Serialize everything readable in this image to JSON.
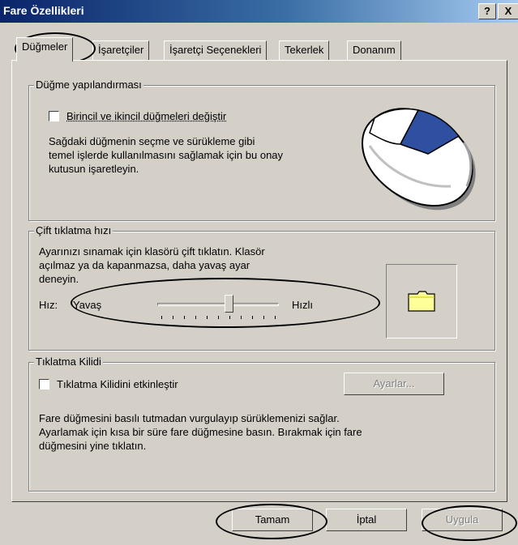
{
  "window": {
    "title": "Fare Özellikleri",
    "help_button": "?",
    "close_button": "X"
  },
  "tabs": [
    {
      "label": "Düğmeler",
      "active": true
    },
    {
      "label": "İşaretçiler",
      "active": false
    },
    {
      "label": "İşaretçi Seçenekleri",
      "active": false
    },
    {
      "label": "Tekerlek",
      "active": false
    },
    {
      "label": "Donanım",
      "active": false
    }
  ],
  "button_config": {
    "group_label": "Düğme yapılandırması",
    "checkbox_label": "Birincil ve ikincil düğmeleri değiştir",
    "checked": false,
    "desc_lines": [
      "Sağdaki düğmenin seçme ve sürükleme gibi",
      "temel işlerde kullanılmasını sağlamak için bu onay",
      "kutusun işaretleyin."
    ]
  },
  "double_click": {
    "group_label": "Çift tıklatma hızı",
    "desc_lines": [
      "Ayarınızı sınamak için klasörü çift tıklatın. Klasör",
      "açılmaz ya da kapanmazsa, daha yavaş ayar",
      "deneyin."
    ],
    "speed_label": "Hız:",
    "slow_label": "Yavaş",
    "fast_label": "Hızlı",
    "slider_level": 0.6
  },
  "click_lock": {
    "group_label": "Tıklatma Kilidi",
    "checkbox_label": "Tıklatma Kilidini etkinleştir",
    "checked": false,
    "settings_button": "Ayarlar...",
    "desc_lines": [
      "Fare düğmesini basılı tutmadan vurgulayıp sürüklemenizi sağlar.",
      "Ayarlamak için kısa bir süre fare düğmesine basın.  Bırakmak için fare",
      "düğmesini yine tıklatın."
    ]
  },
  "footer": {
    "ok": "Tamam",
    "cancel": "İptal",
    "apply": "Uygula"
  },
  "colors": {
    "title_gradient_start": "#0a246a",
    "dialog_bg": "#d4d0c8",
    "folder_yellow": "#ffff99"
  }
}
